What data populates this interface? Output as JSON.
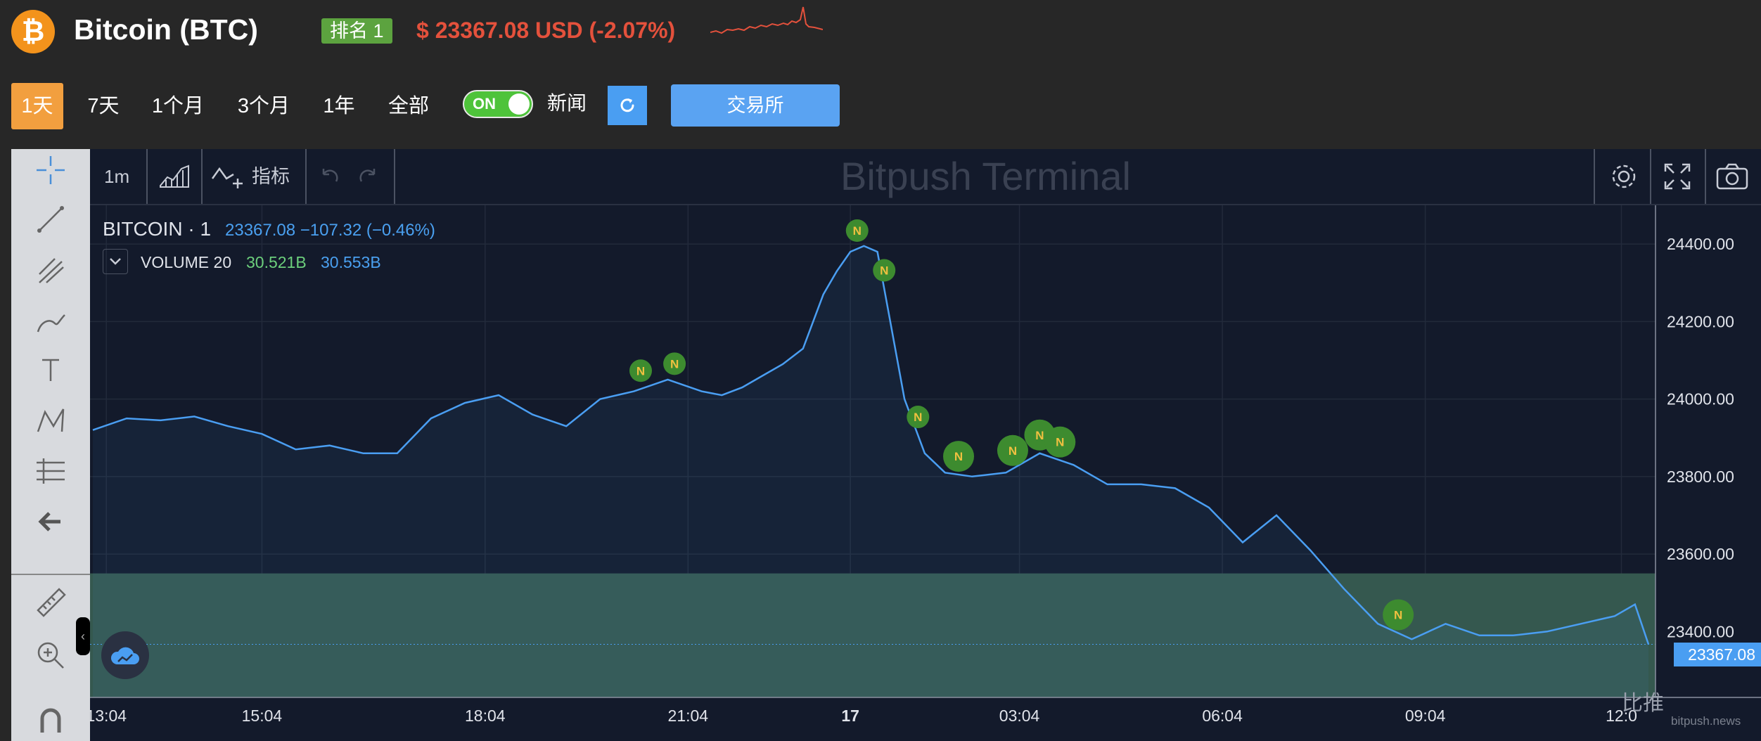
{
  "header": {
    "logo_glyph": "₿",
    "title": "Bitcoin (BTC)",
    "rank": "排名 1",
    "price": "$ 23367.08 USD (-2.07%)",
    "accent_color": "#f3931c",
    "down_color": "#e4513c"
  },
  "ranges": [
    "1天",
    "7天",
    "1个月",
    "3个月",
    "1年",
    "全部"
  ],
  "active_range": "1天",
  "news_toggle": {
    "state": "ON",
    "label": "新闻"
  },
  "exchange_button": "交易所",
  "terminal": {
    "interval": "1m",
    "indicator_label": "指标",
    "watermark": "Bitpush Terminal",
    "symbol": "BITCOIN · 1",
    "price_info": "23367.08 −107.32 (−0.46%)",
    "volume_label": "VOLUME 20",
    "volume_value_1": "30.521B",
    "volume_value_2": "30.553B",
    "last_price_tag": "23367.08",
    "brand": "比推",
    "brand_sub": "bitpush.news"
  },
  "chart_data": {
    "type": "area",
    "y_ticks": [
      "24400.00",
      "24200.00",
      "24000.00",
      "23800.00",
      "23600.00",
      "23400.00"
    ],
    "ylim": [
      23230,
      24500
    ],
    "x_ticks": [
      "13:04",
      "15:04",
      "18:04",
      "21:04",
      "17",
      "03:04",
      "06:04",
      "09:04",
      "12:0"
    ],
    "x": [
      0.0,
      0.5,
      1.0,
      1.5,
      2.0,
      2.5,
      3.0,
      3.5,
      4.0,
      4.5,
      5.0,
      5.5,
      6.0,
      6.5,
      7.0,
      7.5,
      8.0,
      8.5,
      9.0,
      9.3,
      9.6,
      9.9,
      10.2,
      10.5,
      10.8,
      11.0,
      11.2,
      11.4,
      11.6,
      11.8,
      12.0,
      12.3,
      12.6,
      13.0,
      13.5,
      14.0,
      14.5,
      15.0,
      15.5,
      16.0,
      16.5,
      17.0,
      17.5,
      18.0,
      18.5,
      19.0,
      19.5,
      20.0,
      20.5,
      21.0,
      21.5,
      22.0,
      22.5,
      22.8,
      23.0
    ],
    "series": [
      {
        "values": [
          23920,
          23950,
          23945,
          23955,
          23930,
          23910,
          23870,
          23880,
          23860,
          23860,
          23950,
          23990,
          24010,
          23960,
          23930,
          24000,
          24020,
          24050,
          24020,
          24010,
          24030,
          24060,
          24090,
          24130,
          24270,
          24330,
          24380,
          24395,
          24380,
          24190,
          24000,
          23860,
          23810,
          23800,
          23810,
          23860,
          23830,
          23780,
          23780,
          23770,
          23720,
          23630,
          23700,
          23610,
          23510,
          23420,
          23380,
          23420,
          23390,
          23390,
          23400,
          23420,
          23440,
          23470,
          23367
        ]
      }
    ],
    "volume": {
      "level": 23550,
      "color": "#35584f"
    },
    "news_markers_x": [
      8.1,
      8.6,
      11.3,
      11.7,
      12.2,
      12.8,
      13.6,
      14.0,
      14.3,
      19.3
    ],
    "line_color": "#4a9ef2",
    "marker_color": "#3d8b2f"
  }
}
